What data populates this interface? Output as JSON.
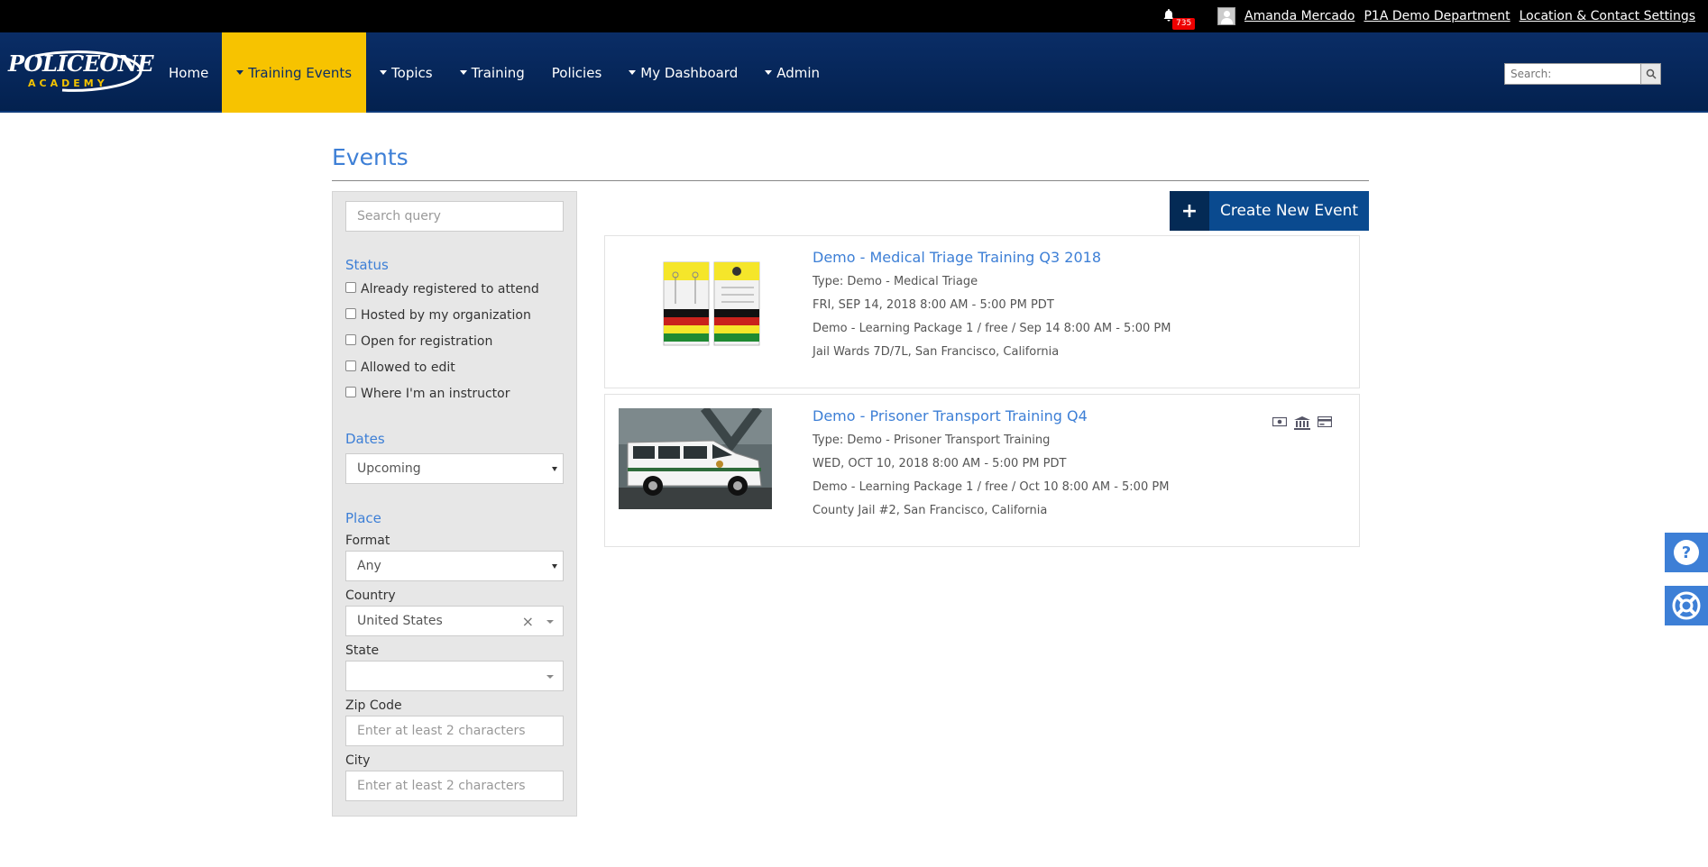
{
  "topbar": {
    "notification_count": "735",
    "user_name": "Amanda Mercado",
    "department": "P1A Demo Department",
    "settings_link": "Location & Contact Settings"
  },
  "logo": {
    "brand": "POLICEONE",
    "sub": "ACADEMY"
  },
  "nav": {
    "items": [
      {
        "label": "Home",
        "caret": false
      },
      {
        "label": "Training Events",
        "caret": true,
        "active": true
      },
      {
        "label": "Topics",
        "caret": true
      },
      {
        "label": "Training",
        "caret": true
      },
      {
        "label": "Policies",
        "caret": false
      },
      {
        "label": "My Dashboard",
        "caret": true
      },
      {
        "label": "Admin",
        "caret": true
      }
    ],
    "search_placeholder": "Search:"
  },
  "page": {
    "title": "Events"
  },
  "sidebar": {
    "search_placeholder": "Search query",
    "status_title": "Status",
    "status_options": [
      "Already registered to attend",
      "Hosted by my organization",
      "Open for registration",
      "Allowed to edit",
      "Where I'm an instructor"
    ],
    "dates_title": "Dates",
    "dates_value": "Upcoming",
    "place_title": "Place",
    "format_label": "Format",
    "format_value": "Any",
    "country_label": "Country",
    "country_value": "United States",
    "state_label": "State",
    "state_value": "",
    "zip_label": "Zip Code",
    "zip_placeholder": "Enter at least 2 characters",
    "city_label": "City",
    "city_placeholder": "Enter at least 2 characters"
  },
  "create_button": {
    "label": "Create New Event"
  },
  "events": [
    {
      "title": "Demo - Medical Triage Training Q3 2018",
      "type": "Type: Demo - Medical Triage",
      "date": "FRI, SEP 14, 2018 8:00 AM - 5:00 PM PDT",
      "package": "Demo - Learning Package 1 / free / Sep 14 8:00 AM - 5:00 PM",
      "location": "Jail Wards 7D/7L, San Francisco, California",
      "image": "triage-tags"
    },
    {
      "title": "Demo - Prisoner Transport Training Q4",
      "type": "Type: Demo - Prisoner Transport Training",
      "date": "WED, OCT 10, 2018 8:00 AM - 5:00 PM PDT",
      "package": "Demo - Learning Package 1 / free / Oct 10 8:00 AM - 5:00 PM",
      "location": "County Jail #2, San Francisco, California",
      "image": "transport-van",
      "payment_icons": [
        "cash-icon",
        "bank-icon",
        "credit-card-icon"
      ]
    }
  ],
  "colors": {
    "nav_bg": "#03214f",
    "active_tab": "#f7c300",
    "link": "#3d7fd6",
    "button": "#0a4a8f"
  }
}
